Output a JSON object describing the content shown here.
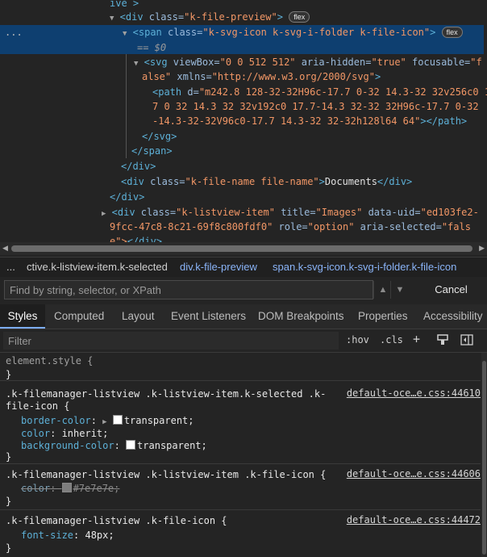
{
  "dom_tree": {
    "line0": {
      "tag_tail": "ive >"
    },
    "line1": {
      "open": "<div",
      "attr": " class=",
      "val": "\"k-file-preview\"",
      "close": ">",
      "badge": "flex"
    },
    "line2": {
      "dots": "...",
      "open": "<span",
      "attr": " class=",
      "val": "\"k-svg-icon k-svg-i-folder k-file-icon\"",
      "close": ">",
      "badge": "flex"
    },
    "line2b": {
      "eq": "== $0"
    },
    "line3": {
      "open": "<svg",
      "a1": " viewBox=",
      "v1": "\"0 0 512 512\"",
      "a2": " aria-hidden=",
      "v2": "\"true\"",
      "a3": " focusable=",
      "v3": "\"f"
    },
    "line3b": {
      "v3b": "alse\"",
      "a4": " xmlns=",
      "v4": "\"http://www.w3.org/2000/svg\"",
      "close": ">"
    },
    "line4": {
      "open": "<path",
      "a1": " d=",
      "v1": "\"m242.8 128-32-32H96c-17.7 0-32 14.3-32 32v256c0 17."
    },
    "line4b": {
      "v1b": "7 0 32 14.3 32 32v192c0 17.7-14.3 32-32 32H96c-17.7 0-32"
    },
    "line4c": {
      "v1c": "-14.3-32-32V96c0-17.7 14.3-32 32-32h128l64 64\"",
      "close": "></path>"
    },
    "line5": {
      "text": "</svg>"
    },
    "line6": {
      "text": "</span>"
    },
    "line7": {
      "text": "</div>"
    },
    "line8": {
      "open": "<div",
      "attr": " class=",
      "val": "\"k-file-name file-name\"",
      "close": ">",
      "text": "Documents",
      "end": "</div>"
    },
    "line9": {
      "text": "</div>"
    },
    "line10": {
      "open": "<div",
      "a1": " class=",
      "v1": "\"k-listview-item\"",
      "a2": " title=",
      "v2": "\"Images\"",
      "a3": " data-uid=",
      "v3": "\"ed103fe2-"
    },
    "line10b": {
      "v3b": "9fcc-47c8-8c21-69f8c800fdf0\"",
      "a4": " role=",
      "v4": "\"option\"",
      "a5": " aria-selected=",
      "v5": "\"fals"
    },
    "line10c": {
      "text": "e\">",
      "end": "</div>"
    }
  },
  "breadcrumb": {
    "dots": "...",
    "c1": "ctive.k-listview-item.k-selected",
    "c2": "div.k-file-preview",
    "c3": "span.k-svg-icon.k-svg-i-folder.k-file-icon"
  },
  "search": {
    "placeholder": "Find by string, selector, or XPath",
    "up": "▲",
    "down": "▼",
    "cancel": "Cancel"
  },
  "tabs": [
    "Styles",
    "Computed",
    "Layout",
    "Event Listeners",
    "DOM Breakpoints",
    "Properties",
    "Accessibility"
  ],
  "filter": {
    "placeholder": "Filter",
    "hov": ":hov",
    "cls": ".cls",
    "plus": "+"
  },
  "styles": {
    "rule0": {
      "selector": "element.style {",
      "close": "}"
    },
    "rule1": {
      "selector_a": ".k-filemanager-listview .k-listview-item.k-selected .k-",
      "selector_b": "file-icon {",
      "source": "default-oce…e.css:44610",
      "p1": "border-color",
      "v1": "transparent",
      "p2": "color",
      "v2": "inherit",
      "p3": "background-color",
      "v3": "transparent",
      "close": "}"
    },
    "rule2": {
      "selector": ".k-filemanager-listview .k-listview-item .k-file-icon {",
      "source": "default-oce…e.css:44606",
      "p1": "color",
      "v1": "#7e7e7e",
      "close": "}"
    },
    "rule3": {
      "selector": ".k-filemanager-listview .k-file-icon {",
      "source": "default-oce…e.css:44472",
      "p1": "font-size",
      "v1": "48px",
      "close": "}"
    }
  },
  "colors": {
    "selected_row": "#0e3f70",
    "tag": "#5db0d7",
    "attr_value": "#f29766",
    "swatch_gray": "#7e7e7e"
  }
}
